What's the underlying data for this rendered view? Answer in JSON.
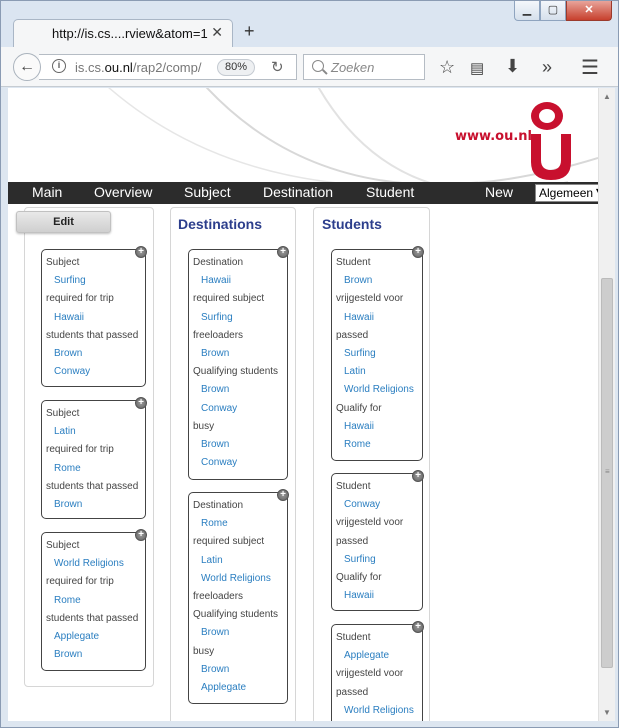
{
  "browser": {
    "tab_title": "http://is.cs....rview&atom=1",
    "url_plain_start": "is.cs.",
    "url_bold": "ou.nl",
    "url_plain_end": "/rap2/comp/",
    "zoom": "80%",
    "search_placeholder": "Zoeken",
    "window_controls": {
      "minimize": "▁",
      "maximize": "▢",
      "close": "✕"
    }
  },
  "banner": {
    "site_url": "www.ou.nl",
    "brand_color": "#c8102e"
  },
  "menu": {
    "items": [
      "Main",
      "Overview",
      "Subject",
      "Destination",
      "Student"
    ],
    "new_label": "New",
    "language": "Algemeen"
  },
  "edit_label": "Edit",
  "columns": [
    {
      "title": "",
      "cards": [
        {
          "rows": [
            {
              "t": "Subject",
              "k": "lbl"
            },
            {
              "t": "Surfing",
              "k": "val"
            },
            {
              "t": "required for trip",
              "k": "lbl"
            },
            {
              "t": "Hawaii",
              "k": "val"
            },
            {
              "t": "students that passed",
              "k": "lbl"
            },
            {
              "t": "Brown",
              "k": "val"
            },
            {
              "t": "Conway",
              "k": "val"
            }
          ]
        },
        {
          "rows": [
            {
              "t": "Subject",
              "k": "lbl"
            },
            {
              "t": "Latin",
              "k": "val"
            },
            {
              "t": "required for trip",
              "k": "lbl"
            },
            {
              "t": "Rome",
              "k": "val"
            },
            {
              "t": "students that passed",
              "k": "lbl"
            },
            {
              "t": "Brown",
              "k": "val"
            }
          ]
        },
        {
          "rows": [
            {
              "t": "Subject",
              "k": "lbl"
            },
            {
              "t": "World Religions",
              "k": "val"
            },
            {
              "t": "required for trip",
              "k": "lbl"
            },
            {
              "t": "Rome",
              "k": "val"
            },
            {
              "t": "students that passed",
              "k": "lbl"
            },
            {
              "t": "Applegate",
              "k": "val"
            },
            {
              "t": "Brown",
              "k": "val"
            }
          ]
        }
      ]
    },
    {
      "title": "Destinations",
      "cards": [
        {
          "rows": [
            {
              "t": "Destination",
              "k": "lbl"
            },
            {
              "t": "Hawaii",
              "k": "val"
            },
            {
              "t": "required subject",
              "k": "lbl"
            },
            {
              "t": "Surfing",
              "k": "val"
            },
            {
              "t": "freeloaders",
              "k": "lbl"
            },
            {
              "t": "Brown",
              "k": "val"
            },
            {
              "t": "Qualifying students",
              "k": "lbl"
            },
            {
              "t": "Brown",
              "k": "val"
            },
            {
              "t": "Conway",
              "k": "val"
            },
            {
              "t": "busy",
              "k": "lbl"
            },
            {
              "t": "Brown",
              "k": "val"
            },
            {
              "t": "Conway",
              "k": "val"
            }
          ]
        },
        {
          "rows": [
            {
              "t": "Destination",
              "k": "lbl"
            },
            {
              "t": "Rome",
              "k": "val"
            },
            {
              "t": "required subject",
              "k": "lbl"
            },
            {
              "t": "Latin",
              "k": "val"
            },
            {
              "t": "World Religions",
              "k": "val"
            },
            {
              "t": "freeloaders",
              "k": "lbl"
            },
            {
              "t": "Qualifying students",
              "k": "lbl"
            },
            {
              "t": "Brown",
              "k": "val"
            },
            {
              "t": "busy",
              "k": "lbl"
            },
            {
              "t": "Brown",
              "k": "val"
            },
            {
              "t": "Applegate",
              "k": "val"
            }
          ]
        }
      ]
    },
    {
      "title": "Students",
      "cards": [
        {
          "rows": [
            {
              "t": "Student",
              "k": "lbl"
            },
            {
              "t": "Brown",
              "k": "val"
            },
            {
              "t": "vrijgesteld voor",
              "k": "lbl"
            },
            {
              "t": "Hawaii",
              "k": "val"
            },
            {
              "t": "passed",
              "k": "lbl"
            },
            {
              "t": "Surfing",
              "k": "val"
            },
            {
              "t": "Latin",
              "k": "val"
            },
            {
              "t": "World Religions",
              "k": "val"
            },
            {
              "t": "Qualify for",
              "k": "lbl"
            },
            {
              "t": "Hawaii",
              "k": "val"
            },
            {
              "t": "Rome",
              "k": "val"
            }
          ]
        },
        {
          "rows": [
            {
              "t": "Student",
              "k": "lbl"
            },
            {
              "t": "Conway",
              "k": "val"
            },
            {
              "t": "vrijgesteld voor",
              "k": "lbl"
            },
            {
              "t": "passed",
              "k": "lbl"
            },
            {
              "t": "Surfing",
              "k": "val"
            },
            {
              "t": "Qualify for",
              "k": "lbl"
            },
            {
              "t": "Hawaii",
              "k": "val"
            }
          ]
        },
        {
          "rows": [
            {
              "t": "Student",
              "k": "lbl"
            },
            {
              "t": "Applegate",
              "k": "val"
            },
            {
              "t": "vrijgesteld voor",
              "k": "lbl"
            },
            {
              "t": "passed",
              "k": "lbl"
            },
            {
              "t": "World Religions",
              "k": "val"
            }
          ]
        }
      ]
    }
  ]
}
